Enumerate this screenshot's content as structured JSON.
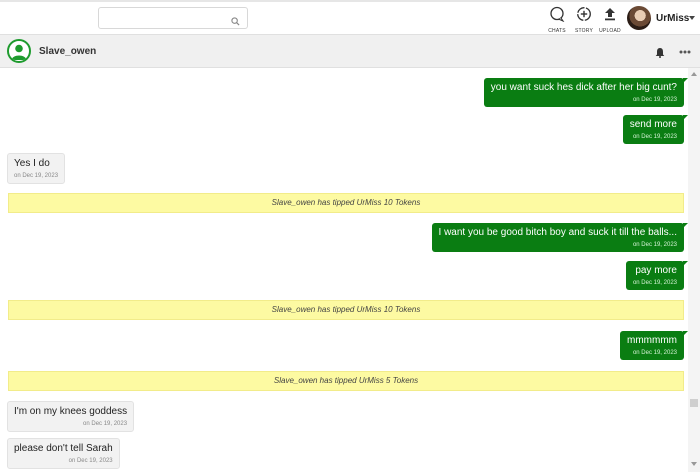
{
  "header": {
    "search": {
      "placeholder": "",
      "value": ""
    },
    "nav": [
      {
        "label": "CHATS",
        "icon": "chat-bubble-icon"
      },
      {
        "label": "STORY",
        "icon": "add-story-icon"
      },
      {
        "label": "UPLOAD",
        "icon": "upload-icon"
      }
    ],
    "user": {
      "name": "UrMiss"
    }
  },
  "conversation": {
    "partner_name": "Slave_owen"
  },
  "messages": [
    {
      "dir": "out",
      "text": "you want suck hes dick after her big cunt?",
      "time": "on Dec 19, 2023"
    },
    {
      "dir": "out",
      "text": "send more",
      "time": "on Dec 19, 2023"
    },
    {
      "dir": "in",
      "text": "Yes I do",
      "time": "on Dec 19, 2023"
    },
    {
      "dir": "tip",
      "text": "Slave_owen has tipped UrMiss 10 Tokens"
    },
    {
      "dir": "out",
      "text": "I want you be good bitch boy and suck it till the balls...",
      "time": "on Dec 19, 2023"
    },
    {
      "dir": "out",
      "text": "pay more",
      "time": "on Dec 19, 2023"
    },
    {
      "dir": "tip",
      "text": "Slave_owen has tipped UrMiss 10 Tokens"
    },
    {
      "dir": "out",
      "text": "mmmmmm",
      "time": "on Dec 19, 2023"
    },
    {
      "dir": "tip",
      "text": "Slave_owen has tipped UrMiss 5 Tokens"
    },
    {
      "dir": "in",
      "text": "I'm on my knees goddess",
      "time": "on Dec 19, 2023"
    },
    {
      "dir": "in",
      "text": "please don't tell Sarah",
      "time": "on Dec 19, 2023"
    }
  ],
  "colors": {
    "outgoing_bubble": "#0a7d12",
    "tip_banner": "#fdfaa2",
    "incoming_bubble": "#f2f2f2"
  }
}
